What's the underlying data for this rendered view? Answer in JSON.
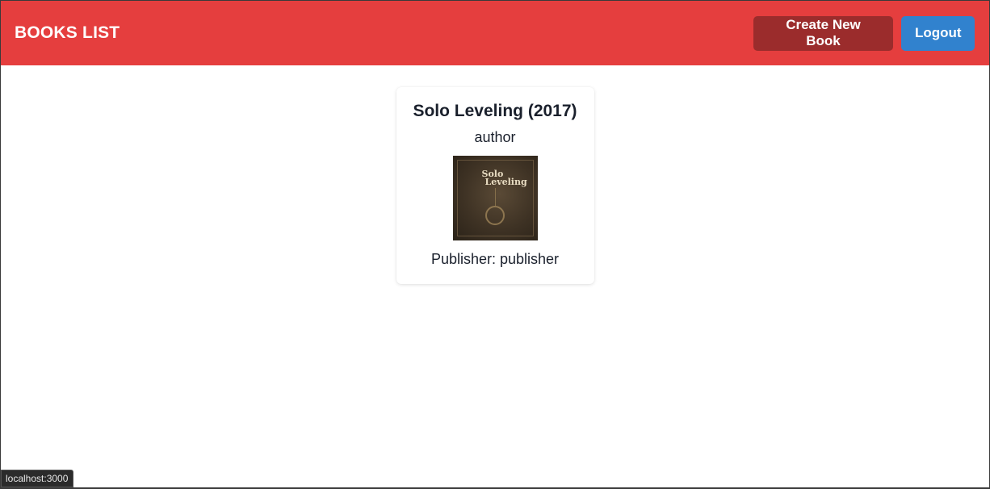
{
  "header": {
    "title": "BOOKS LIST",
    "create_label": "Create New Book",
    "logout_label": "Logout"
  },
  "books": [
    {
      "title": "Solo Leveling (2017)",
      "author": "author",
      "cover_text_line1": "Solo",
      "cover_text_line2": "Leveling",
      "publisher_text": "Publisher: publisher"
    }
  ],
  "status_bar": {
    "url": "localhost:3000"
  },
  "colors": {
    "header_bg": "#e53e3e",
    "create_button_bg": "#9b2c2c",
    "logout_button_bg": "#3182ce"
  }
}
